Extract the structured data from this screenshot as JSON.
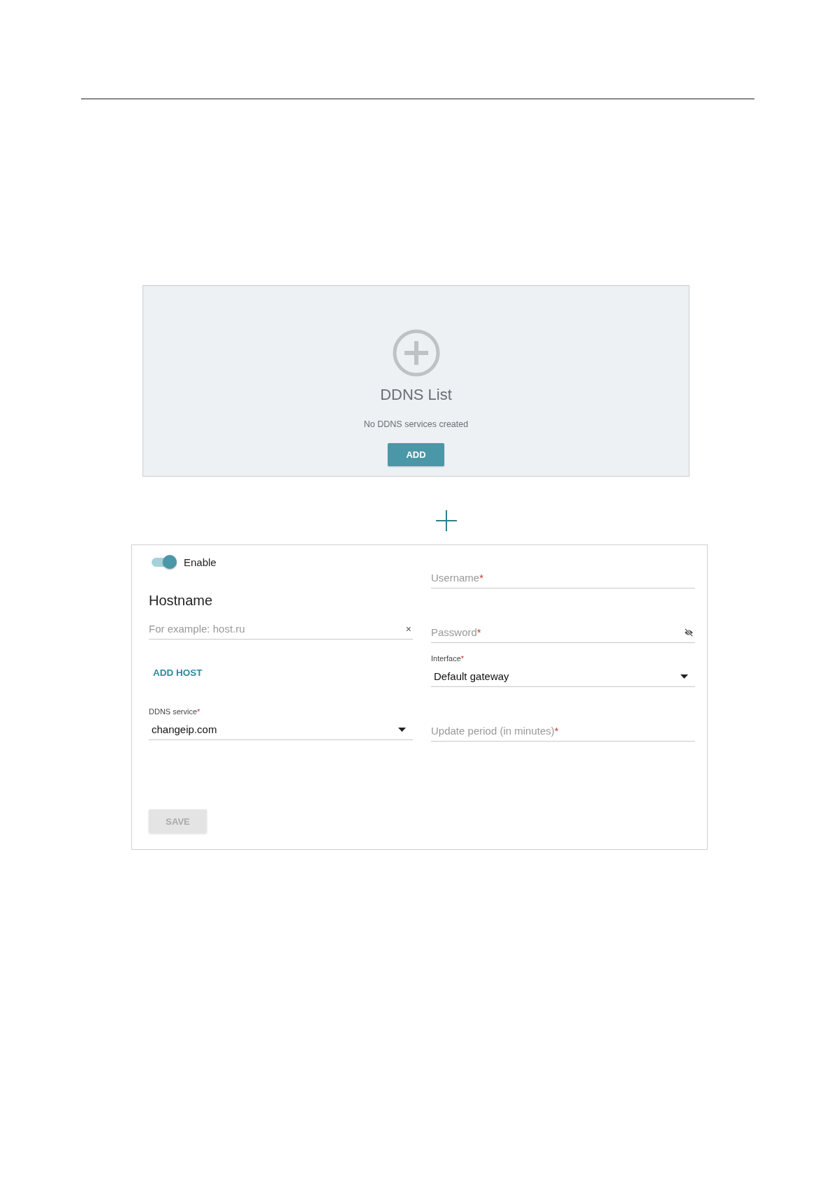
{
  "empty_list": {
    "title": "DDNS List",
    "message": "No DDNS services created",
    "button": "ADD"
  },
  "form": {
    "enable": {
      "label": "Enable",
      "on": true
    },
    "hostname": {
      "heading": "Hostname",
      "placeholder": "For example: host.ru",
      "clear": "×"
    },
    "add_host": "ADD HOST",
    "left_fields": [
      {
        "kind": "select",
        "label": "DDNS service",
        "mark": "*",
        "value": "changeip.com"
      }
    ],
    "right_fields": [
      {
        "kind": "text",
        "label": "Username",
        "mark": "*"
      },
      {
        "kind": "password",
        "label": "Password",
        "mark": "*"
      },
      {
        "kind": "select",
        "label": "Interface",
        "mark": "*",
        "value": "Default gateway"
      },
      {
        "kind": "text",
        "label": "Update period (in minutes)",
        "mark": "*"
      }
    ],
    "save": {
      "label": "SAVE",
      "disabled": true
    }
  }
}
